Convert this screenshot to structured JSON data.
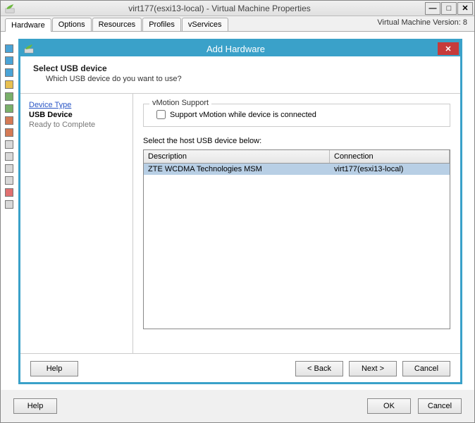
{
  "parentWindow": {
    "title": "virt177(esxi13-local) - Virtual Machine Properties",
    "tabs": [
      "Hardware",
      "Options",
      "Resources",
      "Profiles",
      "vServices"
    ],
    "versionText": "Virtual Machine Version: 8",
    "footer": {
      "help": "Help",
      "ok": "OK",
      "cancel": "Cancel"
    }
  },
  "dialog": {
    "title": "Add Hardware",
    "header": {
      "title": "Select USB device",
      "subtitle": "Which USB device do you want to use?"
    },
    "steps": {
      "deviceType": "Device Type",
      "usbDevice": "USB Device",
      "readyToComplete": "Ready to Complete"
    },
    "vmotion": {
      "legend": "vMotion Support",
      "checkboxLabel": "Support vMotion while device is connected"
    },
    "selectLabel": "Select the host USB device below:",
    "table": {
      "headers": {
        "description": "Description",
        "connection": "Connection"
      },
      "rows": [
        {
          "description": "ZTE WCDMA Technologies MSM",
          "connection": "virt177(esxi13-local)"
        }
      ]
    },
    "footer": {
      "help": "Help",
      "back": "< Back",
      "next": "Next >",
      "cancel": "Cancel"
    }
  }
}
